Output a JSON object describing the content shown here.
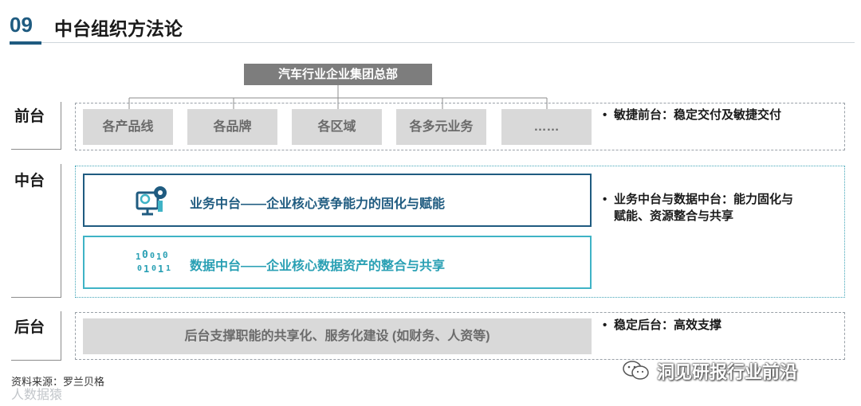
{
  "header": {
    "number": "09",
    "title": "中台组织方法论"
  },
  "hq": {
    "label": "汽车行业企业集团总部"
  },
  "tiers": {
    "front": {
      "label": "前台",
      "items": [
        "各产品线",
        "各品牌",
        "各区域",
        "各多元业务",
        "……"
      ],
      "note": "敏捷前台：稳定交付及敏捷交付"
    },
    "middle": {
      "label": "中台",
      "business": "业务中台——企业核心竞争能力的固化与赋能",
      "data": "数据中台——企业核心数据资产的整合与共享",
      "note_line1": "业务中台与数据中台：能力固化与",
      "note_line2": "赋能、资源整合与共享"
    },
    "back": {
      "label": "后台",
      "item": "后台支撑职能的共享化、服务化建设 (如财务、人资等)",
      "note": "稳定后台：高效支撑"
    }
  },
  "footer": {
    "source": "资料来源：罗兰贝格",
    "watermark": "人数据猿",
    "wechat": "洞见研报行业前沿"
  },
  "colors": {
    "navy": "#1f5b80",
    "teal": "#3fb3c6",
    "gray_box": "#d9d9d9",
    "hq_gray": "#7d7d7d"
  },
  "icons": {
    "business": "gear-monitor-icon",
    "data": "binary-digits-icon",
    "wechat": "wechat-icon"
  }
}
